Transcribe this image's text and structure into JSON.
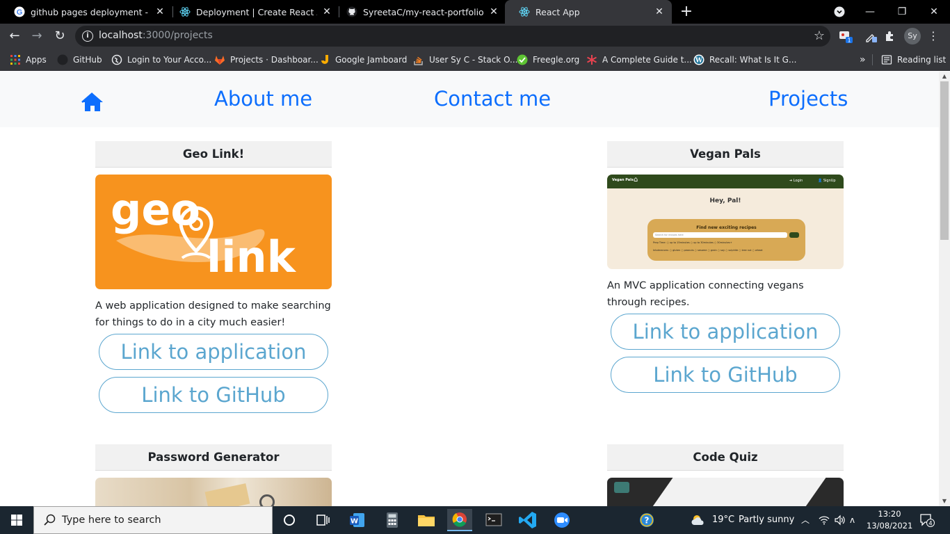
{
  "browser": {
    "tabs": [
      {
        "title": "github pages deployment - Goog",
        "favicon": "google-icon",
        "active": false
      },
      {
        "title": "Deployment | Create React App",
        "favicon": "react-icon",
        "active": false
      },
      {
        "title": "SyreetaC/my-react-portfolio",
        "favicon": "github-icon",
        "active": false
      },
      {
        "title": "React App",
        "favicon": "react-icon",
        "active": true
      }
    ],
    "url_host": "localhost",
    "url_path": ":3000/projects",
    "profile_initials": "Sy",
    "extension_badge": "1"
  },
  "bookmarks": {
    "items": [
      {
        "label": "Apps",
        "icon": "apps-grid-icon",
        "color": "#e8eaed"
      },
      {
        "label": "GitHub",
        "icon": "github-icon",
        "color": "#202124"
      },
      {
        "label": "Login to Your Acco...",
        "icon": "globe-icon",
        "color": "#e8eaed"
      },
      {
        "label": "Projects · Dashboar...",
        "icon": "gitlab-icon",
        "color": "#fc6d26"
      },
      {
        "label": "Google Jamboard",
        "icon": "jamboard-icon",
        "color": "#f9ab00"
      },
      {
        "label": "User Sy C - Stack O...",
        "icon": "stackoverflow-icon",
        "color": "#f48024"
      },
      {
        "label": "Freegle.org",
        "icon": "freegle-icon",
        "color": "#5ec433"
      },
      {
        "label": "A Complete Guide t...",
        "icon": "asterisk-icon",
        "color": "#e8424f"
      },
      {
        "label": "Recall: What Is It G...",
        "icon": "wordpress-icon",
        "color": "#21759b"
      }
    ],
    "overflow": "»",
    "reading_list": "Reading list"
  },
  "site_nav": {
    "about": "About me",
    "contact": "Contact me",
    "projects": "Projects",
    "accent": "#0d6efd"
  },
  "projects": [
    {
      "title": "Geo Link!",
      "description": "A web application designed to make searching for things to do in a city much easier!",
      "app_link": "Link to application",
      "github_link": "Link to GitHub",
      "logo_text_1": "geo",
      "logo_text_2": "link"
    },
    {
      "title": "Vegan Pals",
      "description": "An MVC application connecting vegans through recipes.",
      "app_link": "Link to application",
      "github_link": "Link to GitHub",
      "thumb": {
        "brand": "Vegan Pals",
        "login": "Login",
        "signup": "SignUp",
        "greeting": "Hey, Pal!",
        "search_title": "Find new exciting recipes",
        "search_placeholder": "Search for recipes here",
        "prep_label": "Prep Time:",
        "prep_options": [
          "up to 15minutes",
          "up to 30minutes",
          "30minutes+"
        ],
        "intolerance_label": "Intolerances:",
        "intolerances": [
          "gluten",
          "peanuts",
          "sesame",
          "grain",
          "soy",
          "sulphite",
          "tree nut",
          "wheat"
        ]
      }
    },
    {
      "title": "Password Generator"
    },
    {
      "title": "Code Quiz"
    }
  ],
  "taskbar": {
    "search_placeholder": "Type here to search",
    "weather_temp": "19°C",
    "weather_text": "Partly sunny",
    "time": "13:20",
    "date": "13/08/2021",
    "notifications": "4"
  }
}
